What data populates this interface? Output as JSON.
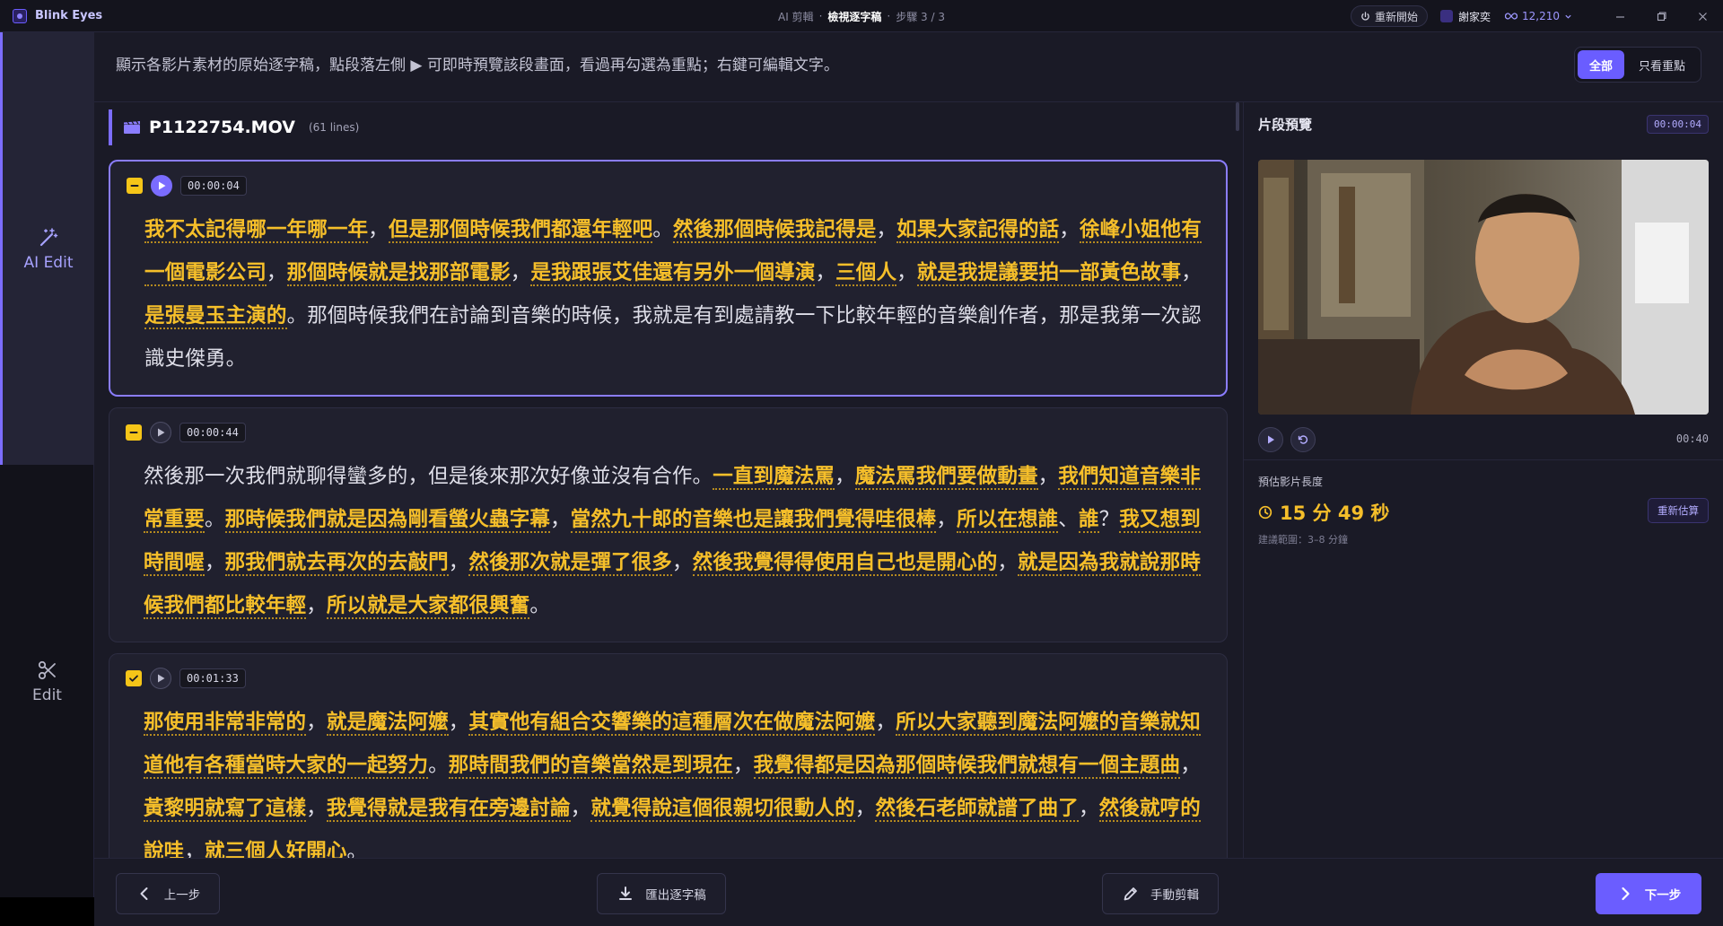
{
  "app": {
    "name": "Blink Eyes"
  },
  "title": {
    "part1": "AI 剪輯",
    "sep1": "·",
    "part2": "檢視逐字稿",
    "sep2": "·",
    "part3": "步驟 3 / 3"
  },
  "titlebar": {
    "restart_label": "重新開始",
    "user_name": "謝家奕",
    "credits": "12,210"
  },
  "rail": {
    "ai_label": "AI Edit",
    "edit_label": "Edit"
  },
  "header": {
    "description": "顯示各影片素材的原始逐字稿，點段落左側 ▶ 可即時預覽該段畫面，看過再勾選為重點；右鍵可編輯文字。",
    "filter_all": "全部",
    "filter_key": "只看重點"
  },
  "file": {
    "name": "P1122754.MOV",
    "count": "(61 lines)"
  },
  "segments": [
    {
      "time": "00:00:04",
      "parts": [
        {
          "t": "我不太記得哪一年哪一年",
          "k": true
        },
        {
          "t": "，",
          "k": false
        },
        {
          "t": "但是那個時候我們都還年輕吧",
          "k": true
        },
        {
          "t": "。",
          "k": false
        },
        {
          "t": "然後那個時候我記得是",
          "k": true
        },
        {
          "t": "，",
          "k": false
        },
        {
          "t": "如果大家記得的話",
          "k": true
        },
        {
          "t": "，",
          "k": false
        },
        {
          "t": "徐峰小姐他有一個電影公司",
          "k": true
        },
        {
          "t": "，",
          "k": false
        },
        {
          "t": "那個時候就是找那部電影",
          "k": true
        },
        {
          "t": "，",
          "k": false
        },
        {
          "t": "是我跟張艾佳還有另外一個導演",
          "k": true
        },
        {
          "t": "，",
          "k": false
        },
        {
          "t": "三個人",
          "k": true
        },
        {
          "t": "，",
          "k": false
        },
        {
          "t": "就是我提議要拍一部黃色故事",
          "k": true
        },
        {
          "t": "，",
          "k": false
        },
        {
          "t": "是張曼玉主演的",
          "k": true
        },
        {
          "t": "。那個時候我們在討論到音樂的時候，我就是有到處請教一下比較年輕的音樂創作者，那是我第一次認識史傑勇。",
          "k": false
        }
      ]
    },
    {
      "time": "00:00:44",
      "parts": [
        {
          "t": "然後那一次我們就聊得蠻多的，但是後來那次好像並沒有合作。",
          "k": false
        },
        {
          "t": "一直到魔法罵",
          "k": true
        },
        {
          "t": "，",
          "k": false
        },
        {
          "t": "魔法罵我們要做動畫",
          "k": true
        },
        {
          "t": "，",
          "k": false
        },
        {
          "t": "我們知道音樂非常重要",
          "k": true
        },
        {
          "t": "。",
          "k": false
        },
        {
          "t": "那時候我們就是因為剛看螢火蟲字幕",
          "k": true
        },
        {
          "t": "，",
          "k": false
        },
        {
          "t": "當然九十郎的音樂也是讓我們覺得哇很棒",
          "k": true
        },
        {
          "t": "，",
          "k": false
        },
        {
          "t": "所以在想誰",
          "k": true
        },
        {
          "t": "、",
          "k": false
        },
        {
          "t": "誰",
          "k": true
        },
        {
          "t": "？",
          "k": false
        },
        {
          "t": "我又想到時間喔",
          "k": true
        },
        {
          "t": "，",
          "k": false
        },
        {
          "t": "那我們就去再次的去敲門",
          "k": true
        },
        {
          "t": "，",
          "k": false
        },
        {
          "t": "然後那次就是彈了很多",
          "k": true
        },
        {
          "t": "，",
          "k": false
        },
        {
          "t": "然後我覺得得使用自己也是開心的",
          "k": true
        },
        {
          "t": "，",
          "k": false
        },
        {
          "t": "就是因為我就說那時候我們都比較年輕",
          "k": true
        },
        {
          "t": "，",
          "k": false
        },
        {
          "t": "所以就是大家都很興奮",
          "k": true
        },
        {
          "t": "。",
          "k": false
        }
      ]
    },
    {
      "time": "00:01:33",
      "parts": [
        {
          "t": "那使用非常非常的",
          "k": true
        },
        {
          "t": "，",
          "k": false
        },
        {
          "t": "就是魔法阿嬤",
          "k": true
        },
        {
          "t": "，",
          "k": false
        },
        {
          "t": "其實他有組合交響樂的這種層次在做魔法阿嬤",
          "k": true
        },
        {
          "t": "，",
          "k": false
        },
        {
          "t": "所以大家聽到魔法阿嬤的音樂就知道他有各種當時大家的一起努力",
          "k": true
        },
        {
          "t": "。",
          "k": false
        },
        {
          "t": "那時間我們的音樂當然是到現在",
          "k": true
        },
        {
          "t": "，",
          "k": false
        },
        {
          "t": "我覺得都是因為那個時候我們就想有一個主題曲",
          "k": true
        },
        {
          "t": "，",
          "k": false
        },
        {
          "t": "黃黎明就寫了這樣",
          "k": true
        },
        {
          "t": "，",
          "k": false
        },
        {
          "t": "我覺得就是我有在旁邊討論",
          "k": true
        },
        {
          "t": "，",
          "k": false
        },
        {
          "t": "就覺得說這個很親切很動人的",
          "k": true
        },
        {
          "t": "，",
          "k": false
        },
        {
          "t": "然後石老師就譜了曲了",
          "k": true
        },
        {
          "t": "，",
          "k": false
        },
        {
          "t": "然後就哼的說哇",
          "k": true
        },
        {
          "t": "，",
          "k": false
        },
        {
          "t": "就三個人好開心",
          "k": true
        },
        {
          "t": "。",
          "k": false
        }
      ]
    }
  ],
  "preview": {
    "title": "片段預覽",
    "current_time": "00:00:04",
    "end_time": "00:40",
    "estimate_label": "預估影片長度",
    "estimate_value": "15 分 49 秒",
    "estimate_range": "建議範圍：3–8 分鐘",
    "reestimate_label": "重新估算"
  },
  "bottom": {
    "prev_label": "上一步",
    "export_label": "匯出逐字稿",
    "manual_label": "手動剪輯",
    "next_label": "下一步"
  },
  "colors": {
    "accent": "#6b5dff",
    "highlight": "#f6bf2a",
    "background": "#1a1a26"
  }
}
